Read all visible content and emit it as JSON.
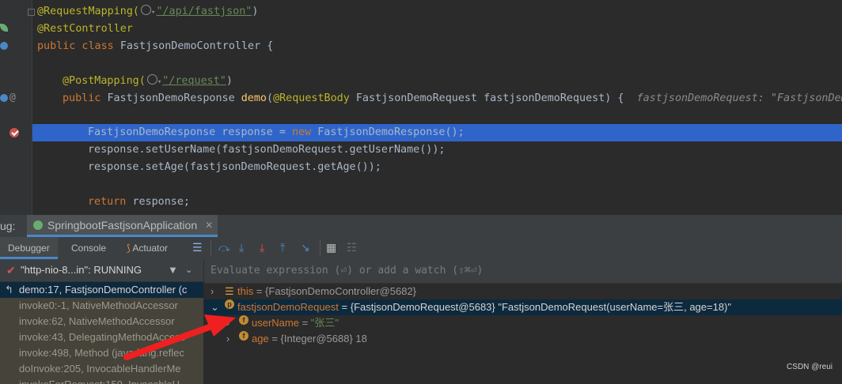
{
  "editor": {
    "lines": {
      "l1_ann": "@RequestMapping(",
      "l1_str": "\"/api/fastjson\"",
      "l1_close": ")",
      "l2": "@RestController",
      "l3_kw": "public class ",
      "l3_rest": "FastjsonDemoController {",
      "l5_ann": "@PostMapping(",
      "l5_str": "\"/request\"",
      "l5_close": ")",
      "l6_kw": "public ",
      "l6_type": "FastjsonDemoResponse ",
      "l6_fn": "demo",
      "l6_open": "(",
      "l6_ann": "@RequestBody ",
      "l6_rest": "FastjsonDemoRequest fastjsonDemoRequest) {",
      "l6_hint": "fastjsonDemoRequest: \"FastjsonDem",
      "l8_a": "FastjsonDemoResponse response = ",
      "l8_kw": "new ",
      "l8_b": "FastjsonDemoResponse();",
      "l9": "response.setUserName(fastjsonDemoRequest.getUserName());",
      "l10": "response.setAge(fastjsonDemoRequest.getAge());",
      "l12_kw": "return ",
      "l12_rest": "response;"
    }
  },
  "debug": {
    "label": "ug:",
    "run_config": "SpringbootFastjsonApplication",
    "tabs": {
      "debugger": "Debugger",
      "console": "Console",
      "actuator": "Actuator"
    },
    "thread": "\"http-nio-8...in\": RUNNING",
    "frames": [
      "demo:17, FastjsonDemoController (c",
      "invoke0:-1, NativeMethodAccessor",
      "invoke:62, NativeMethodAccessor",
      "invoke:43, DelegatingMethodAccess",
      "invoke:498, Method (java.lang.reflec",
      "doInvoke:205, InvocableHandlerMe",
      "invokeForRequest:150, InvocableH"
    ],
    "eval_placeholder": "Evaluate expression (⏎) or add a watch (⇧⌘⏎)",
    "variables": {
      "this_name": "this",
      "this_value": " = {FastjsonDemoController@5682}",
      "req_name": "fastjsonDemoRequest",
      "req_value": " = {FastjsonDemoRequest@5683} \"FastjsonDemoRequest(userName=张三, age=18)\"",
      "user_name": "userName",
      "user_eq": " = ",
      "user_value": "\"张三\"",
      "age_name": "age",
      "age_value": " = {Integer@5688} 18"
    }
  },
  "watermark": "CSDN @reui"
}
